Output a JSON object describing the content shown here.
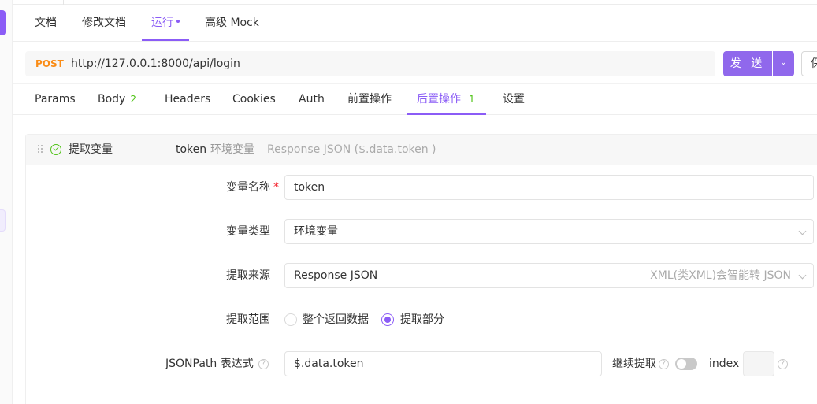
{
  "top_tabs": {
    "doc": "文档",
    "edit_doc": "修改文档",
    "run": "运行",
    "mock": "高级 Mock"
  },
  "request": {
    "method": "POST",
    "url": "http://127.0.0.1:8000/api/login",
    "send_label": "发 送",
    "save_label": "保"
  },
  "req_tabs": {
    "params": "Params",
    "body": "Body",
    "body_count": "2",
    "headers": "Headers",
    "cookies": "Cookies",
    "auth": "Auth",
    "pre": "前置操作",
    "post": "后置操作",
    "post_count": "1",
    "settings": "设置"
  },
  "extract": {
    "title": "提取变量",
    "summary_var": "token",
    "summary_scope": "环境变量",
    "summary_expr": "Response JSON ($.data.token )",
    "var_name_label": "变量名称",
    "required_mark": "*",
    "var_name_value": "token",
    "var_type_label": "变量类型",
    "var_type_value": "环境变量",
    "source_label": "提取来源",
    "source_value": "Response JSON",
    "source_hint": "XML(类XML)会智能转 JSON",
    "range_label": "提取范围",
    "range_all": "整个返回数据",
    "range_part": "提取部分",
    "jsonpath_label": "JSONPath 表达式",
    "jsonpath_value": "$.data.token",
    "continue_label": "继续提取",
    "index_label": "index",
    "help_glyph": "?"
  },
  "colors": {
    "accent": "#8b5cf6",
    "method": "#fa8c16",
    "success": "#52c41a"
  }
}
